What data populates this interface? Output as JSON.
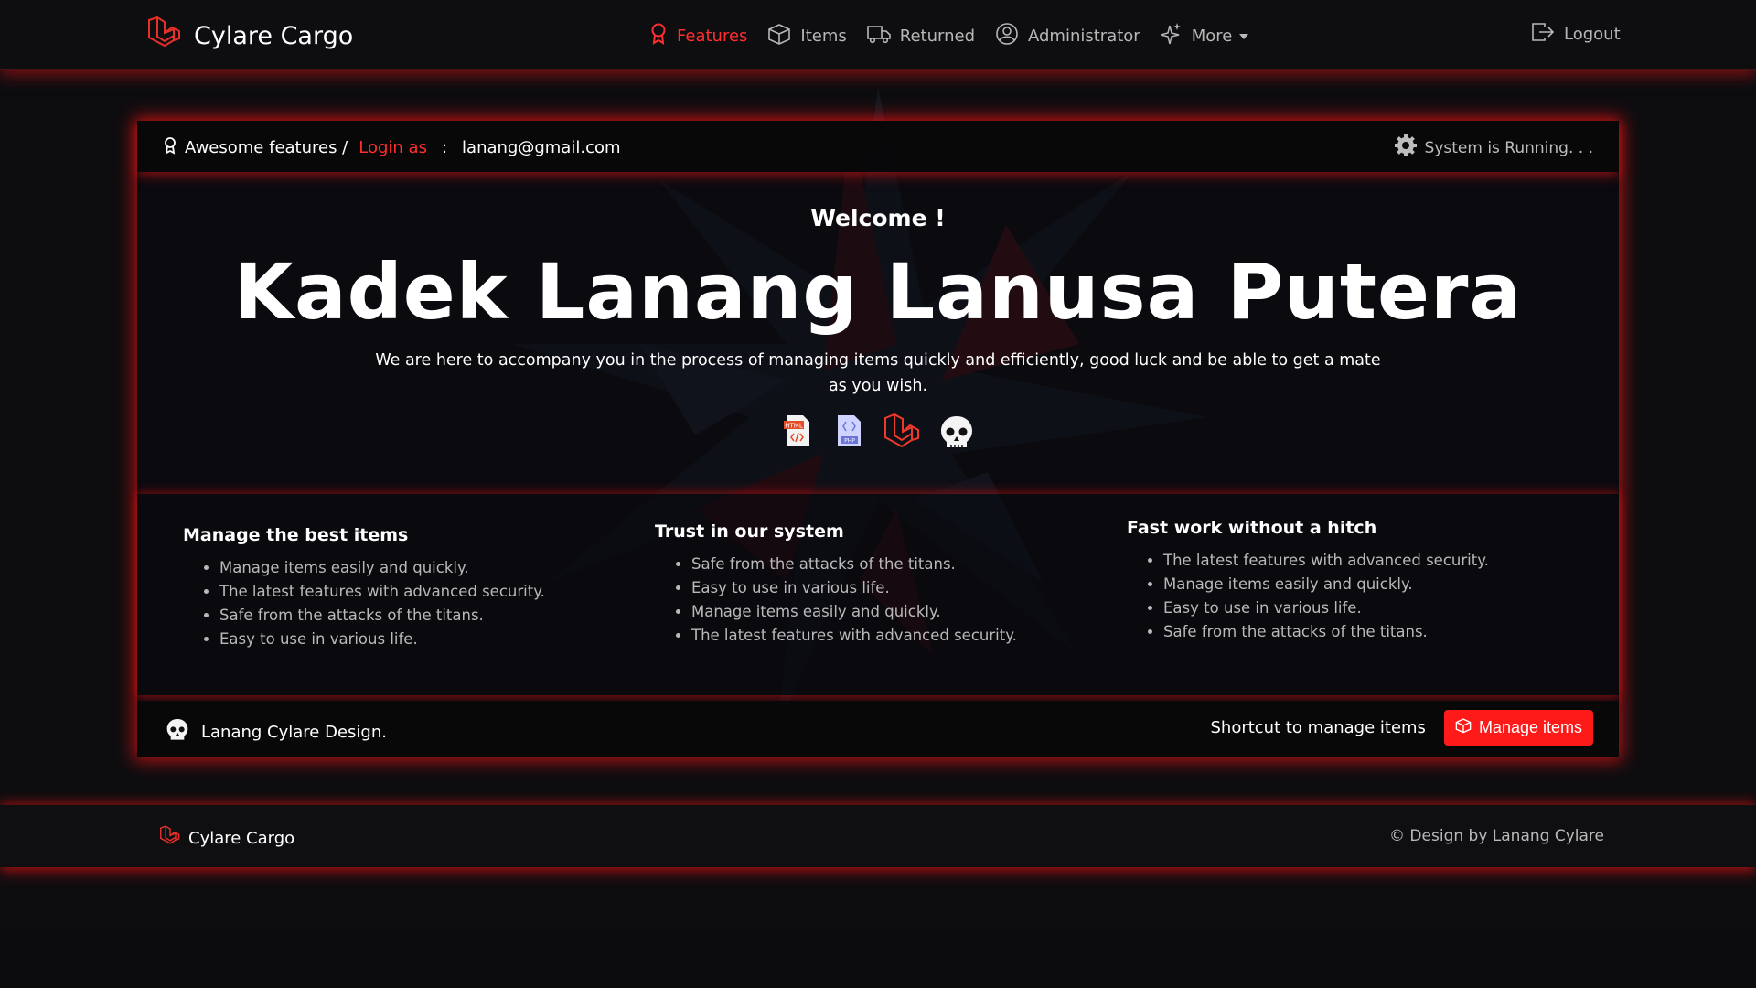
{
  "navbar": {
    "brand": "Cylare Cargo",
    "items": [
      {
        "label": "Features",
        "icon": "award-icon",
        "active": true
      },
      {
        "label": "Items",
        "icon": "box-icon"
      },
      {
        "label": "Returned",
        "icon": "truck-icon"
      },
      {
        "label": "Administrator",
        "icon": "user-circle-icon"
      },
      {
        "label": "More",
        "icon": "sparkles-icon"
      }
    ],
    "logout": "Logout"
  },
  "card": {
    "breadcrumb": {
      "label": "Awesome features /",
      "login_as": "Login as",
      "separator": ":",
      "email": "lanang@gmail.com"
    },
    "status": "System is Running. . .",
    "welcome": "Welcome !",
    "name": "Kadek Lanang Lanusa Putera",
    "tagline": "We are here to accompany you in the process of managing items quickly and efficiently, good luck and be able to get a mate as you wish.",
    "tech_icons": [
      "html-file-icon",
      "php-file-icon",
      "laravel-icon",
      "skull-icon"
    ],
    "features": [
      {
        "title": "Manage the best items",
        "items": [
          "Manage items easily and quickly.",
          "The latest features with advanced security.",
          "Safe from the attacks of the titans.",
          "Easy to use in various life."
        ]
      },
      {
        "title": "Trust in our system",
        "items": [
          "Safe from the attacks of the titans.",
          "Easy to use in various life.",
          "Manage items easily and quickly.",
          "The latest features with advanced security."
        ]
      },
      {
        "title": "Fast work without a hitch",
        "items": [
          "The latest features with advanced security.",
          "Manage items easily and quickly.",
          "Easy to use in various life.",
          "Safe from the attacks of the titans."
        ]
      }
    ],
    "footer": {
      "design_label": "Lanang Cylare Design.",
      "shortcut_label": "Shortcut to manage items",
      "button_label": "Manage items"
    }
  },
  "page_footer": {
    "brand": "Cylare Cargo",
    "copyright": "© Design by Lanang Cylare"
  },
  "colors": {
    "accent": "#ff1a1a",
    "background": "#0d0d10",
    "muted_text": "#b9b9b9"
  }
}
